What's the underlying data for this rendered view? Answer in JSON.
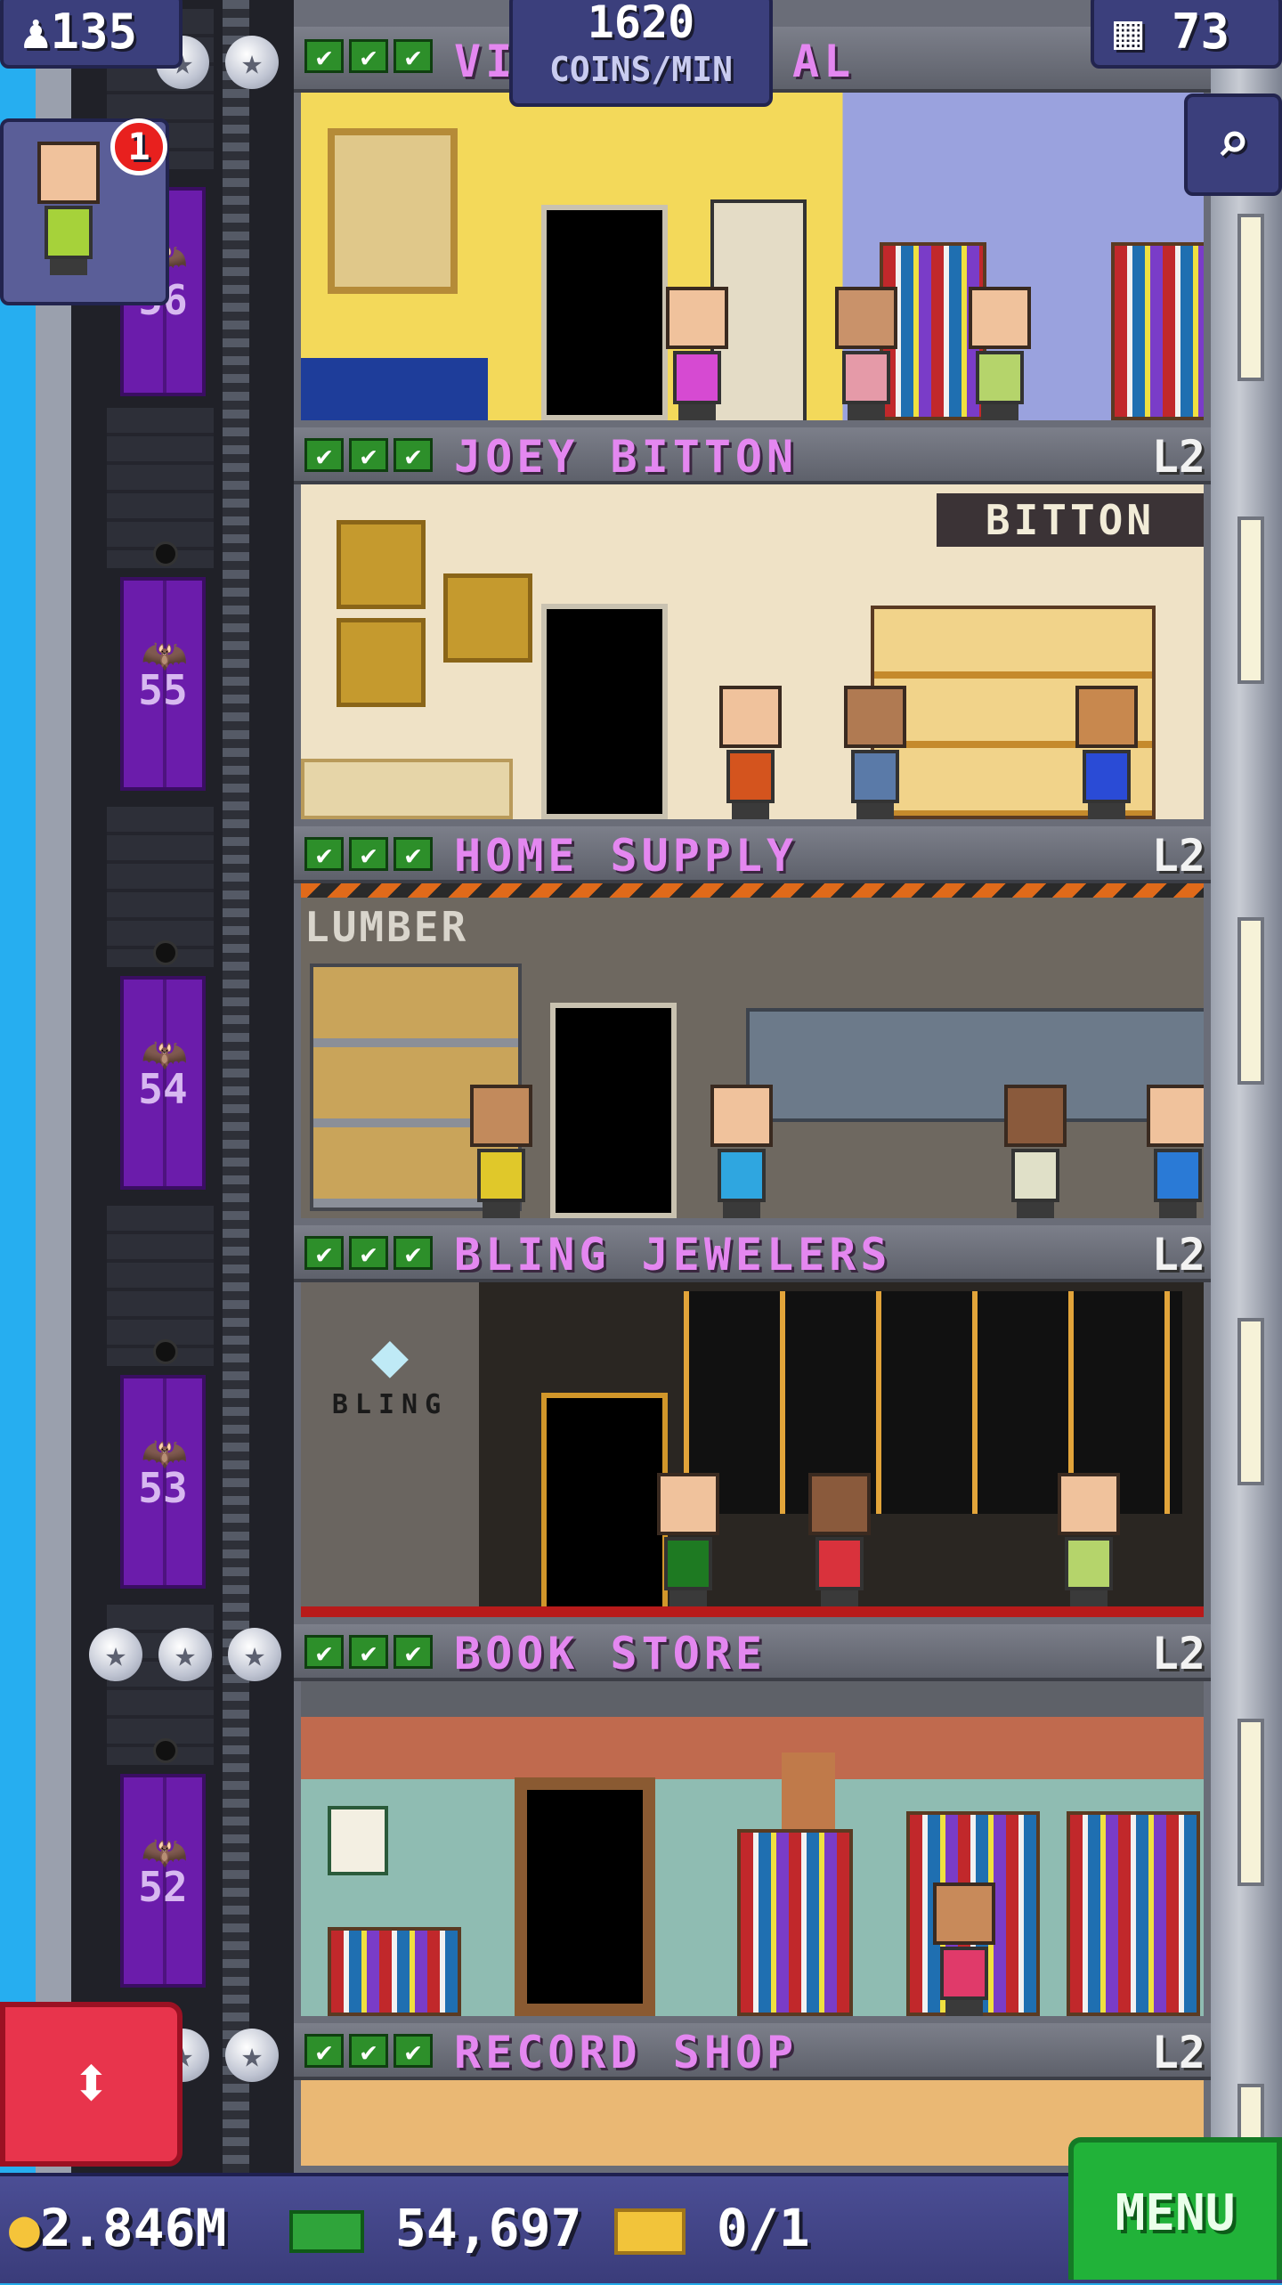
{
  "hud": {
    "population": "135",
    "coins_per_min_value": "1620",
    "coins_per_min_label": "COINS/MIN",
    "floors_count": "73",
    "notification_badge": "1"
  },
  "top_floor_partial": {
    "name_partial": "VI",
    "name_partial_right": "AL"
  },
  "floors": [
    {
      "number": "56",
      "name": "",
      "level": ""
    },
    {
      "number": "55",
      "name": "JOEY BITTON",
      "level": "L2",
      "sign": "BITTON"
    },
    {
      "number": "54",
      "name": "HOME SUPPLY",
      "level": "L2",
      "sign": "LUMBER"
    },
    {
      "number": "53",
      "name": "BLING JEWELERS",
      "level": "L2",
      "sign": "BLING"
    },
    {
      "number": "52",
      "name": "BOOK STORE",
      "level": "L2"
    },
    {
      "number": "",
      "name": "RECORD SHOP",
      "level": "L2"
    }
  ],
  "bottom": {
    "coins": "2.846M",
    "bux": "54,697",
    "tickets": "0/1",
    "menu_label": "MENU"
  },
  "colors": {
    "accent_floor_name": "#e487f0",
    "menu_green": "#21b239",
    "elevator_red": "#e8344c",
    "hud_blue": "#3b3f7c"
  }
}
